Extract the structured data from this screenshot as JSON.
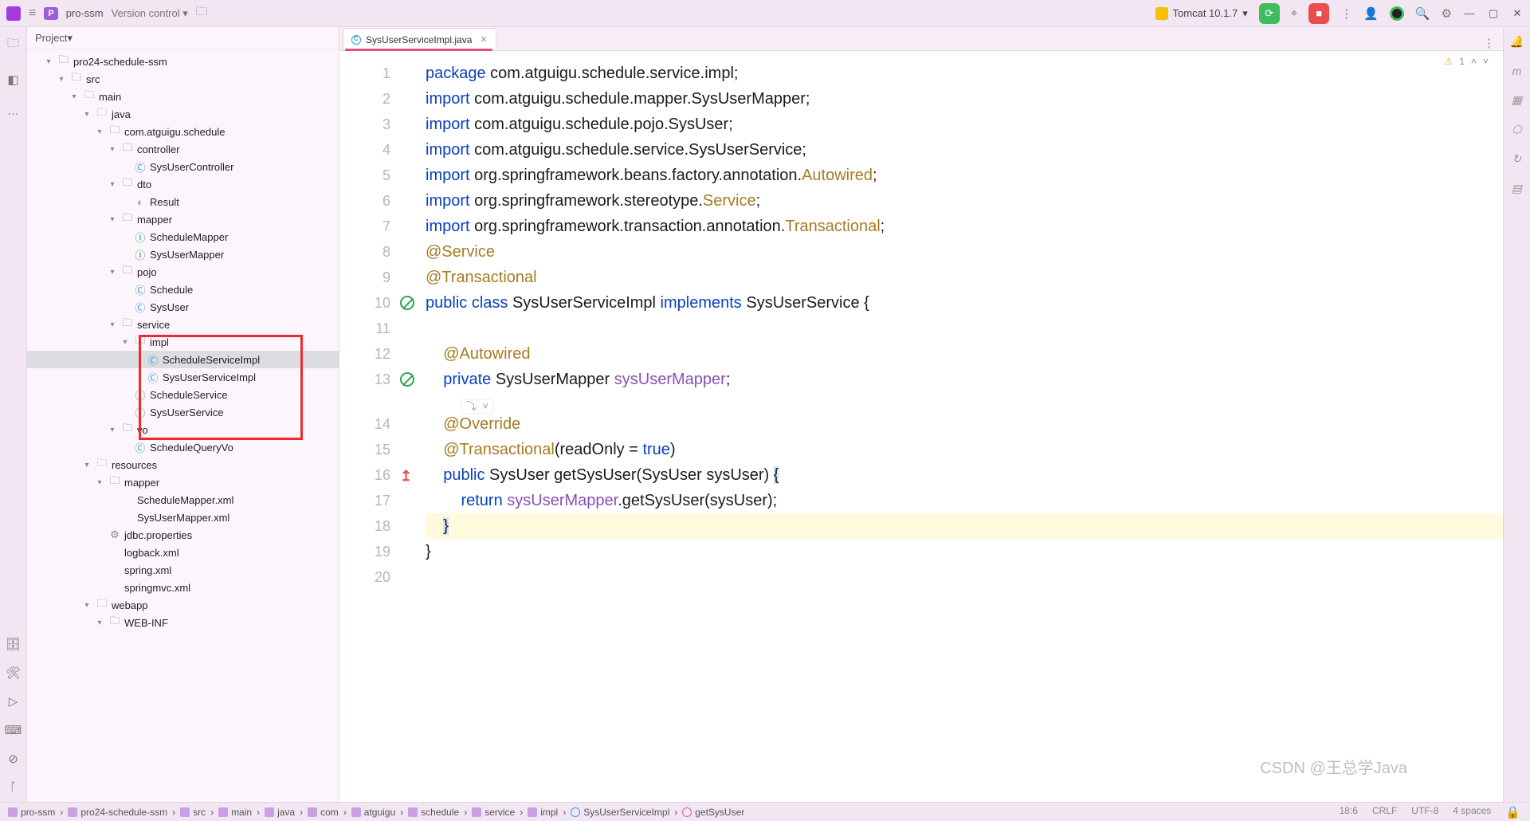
{
  "topbar": {
    "project_badge": "P",
    "project_name": "pro-ssm",
    "version_control": "Version control",
    "run_config": "Tomcat 10.1.7"
  },
  "panel": {
    "title": "Project"
  },
  "tree": {
    "root": "pro24-schedule-ssm",
    "nodes": [
      {
        "depth": 1,
        "icon": "fold-dir",
        "label": "src",
        "open": true
      },
      {
        "depth": 2,
        "icon": "fold-src",
        "label": "main",
        "open": true
      },
      {
        "depth": 3,
        "icon": "fold-src",
        "label": "java",
        "open": true
      },
      {
        "depth": 4,
        "icon": "fold-pkg",
        "label": "com.atguigu.schedule",
        "open": true
      },
      {
        "depth": 5,
        "icon": "fold-pkg",
        "label": "controller",
        "open": true
      },
      {
        "depth": 6,
        "icon": "file-class",
        "label": "SysUserController"
      },
      {
        "depth": 5,
        "icon": "fold-pkg",
        "label": "dto",
        "open": true
      },
      {
        "depth": 6,
        "icon": "file-dto",
        "label": "Result"
      },
      {
        "depth": 5,
        "icon": "fold-pkg",
        "label": "mapper",
        "open": true
      },
      {
        "depth": 6,
        "icon": "file-int",
        "label": "ScheduleMapper"
      },
      {
        "depth": 6,
        "icon": "file-int",
        "label": "SysUserMapper"
      },
      {
        "depth": 5,
        "icon": "fold-pkg",
        "label": "pojo",
        "open": true
      },
      {
        "depth": 6,
        "icon": "file-class",
        "label": "Schedule"
      },
      {
        "depth": 6,
        "icon": "file-class",
        "label": "SysUser"
      },
      {
        "depth": 5,
        "icon": "fold-pkg",
        "label": "service",
        "open": true
      },
      {
        "depth": 6,
        "icon": "fold-pkg",
        "label": "impl",
        "open": true
      },
      {
        "depth": 7,
        "icon": "file-class",
        "label": "ScheduleServiceImpl",
        "selected": true
      },
      {
        "depth": 7,
        "icon": "file-class",
        "label": "SysUserServiceImpl"
      },
      {
        "depth": 6,
        "icon": "file-int",
        "label": "ScheduleService"
      },
      {
        "depth": 6,
        "icon": "file-int",
        "label": "SysUserService"
      },
      {
        "depth": 5,
        "icon": "fold-pkg",
        "label": "vo",
        "open": true
      },
      {
        "depth": 6,
        "icon": "file-class",
        "label": "ScheduleQueryVo"
      },
      {
        "depth": 3,
        "icon": "fold-src",
        "label": "resources",
        "open": true
      },
      {
        "depth": 4,
        "icon": "fold-dir",
        "label": "mapper",
        "open": true
      },
      {
        "depth": 5,
        "icon": "file-xml",
        "label": "ScheduleMapper.xml"
      },
      {
        "depth": 5,
        "icon": "file-xml",
        "label": "SysUserMapper.xml"
      },
      {
        "depth": 4,
        "icon": "file-prop",
        "label": "jdbc.properties"
      },
      {
        "depth": 4,
        "icon": "file-xml",
        "label": "logback.xml"
      },
      {
        "depth": 4,
        "icon": "file-xml",
        "label": "spring.xml"
      },
      {
        "depth": 4,
        "icon": "file-xml",
        "label": "springmvc.xml"
      },
      {
        "depth": 3,
        "icon": "fold-src",
        "label": "webapp",
        "open": true
      },
      {
        "depth": 4,
        "icon": "fold-dir",
        "label": "WEB-INF",
        "open": true
      }
    ]
  },
  "tab": {
    "name": "SysUserServiceImpl.java"
  },
  "editor_meta": {
    "warn_count": "1"
  },
  "code_lines": [
    {
      "n": 1,
      "html": "<span class='kw'>package</span> com.atguigu.schedule.service.impl;"
    },
    {
      "n": 2,
      "html": "<span class='kw'>import</span> com.atguigu.schedule.mapper.SysUserMapper;"
    },
    {
      "n": 3,
      "html": "<span class='kw'>import</span> com.atguigu.schedule.pojo.SysUser;"
    },
    {
      "n": 4,
      "html": "<span class='kw'>import</span> com.atguigu.schedule.service.SysUserService;"
    },
    {
      "n": 5,
      "html": "<span class='kw'>import</span> org.springframework.beans.factory.annotation.<span class='ann'>Autowired</span>;"
    },
    {
      "n": 6,
      "html": "<span class='kw'>import</span> org.springframework.stereotype.<span class='ann'>Service</span>;"
    },
    {
      "n": 7,
      "html": "<span class='kw'>import</span> org.springframework.transaction.annotation.<span class='ann'>Transactional</span>;"
    },
    {
      "n": 8,
      "html": "<span class='ann'>@Service</span>"
    },
    {
      "n": 9,
      "html": "<span class='ann'>@Transactional</span>"
    },
    {
      "n": 10,
      "html": "<span class='kw'>public class</span> SysUserServiceImpl <span class='kw'>implements</span> SysUserService {",
      "gicon": "nosmoking"
    },
    {
      "n": 11,
      "html": ""
    },
    {
      "n": 12,
      "html": "    <span class='ann'>@Autowired</span>"
    },
    {
      "n": 13,
      "html": "    <span class='kw'>private</span> SysUserMapper <span class='id-purple'>sysUserMapper</span>;",
      "gicon": "nosmoking"
    },
    {
      "inlay": true,
      "label": "⤵  ˅"
    },
    {
      "n": 14,
      "html": "    <span class='ann'>@Override</span>"
    },
    {
      "n": 15,
      "html": "    <span class='ann'>@Transactional</span>(readOnly = <span class='kw'>true</span>)"
    },
    {
      "n": 16,
      "html": "    <span class='kw'>public</span> SysUser getSysUser(SysUser sysUser) <span class='hl-sel'>{</span>",
      "gicon": "upred"
    },
    {
      "n": 17,
      "html": "        <span class='kw'>return</span> <span class='id-purple'>sysUserMapper</span>.getSysUser(sysUser);"
    },
    {
      "n": 18,
      "html": "    <span class='hl-sel'>}</span>",
      "hl": true
    },
    {
      "n": 19,
      "html": "}"
    },
    {
      "n": 20,
      "html": ""
    }
  ],
  "breadcrumbs": [
    {
      "icon": "fold",
      "label": "pro-ssm"
    },
    {
      "icon": "fold",
      "label": "pro24-schedule-ssm"
    },
    {
      "icon": "fold",
      "label": "src"
    },
    {
      "icon": "fold",
      "label": "main"
    },
    {
      "icon": "fold",
      "label": "java"
    },
    {
      "icon": "fold",
      "label": "com"
    },
    {
      "icon": "fold",
      "label": "atguigu"
    },
    {
      "icon": "fold",
      "label": "schedule"
    },
    {
      "icon": "fold",
      "label": "service"
    },
    {
      "icon": "fold",
      "label": "impl"
    },
    {
      "icon": "cls",
      "label": "SysUserServiceImpl"
    },
    {
      "icon": "meth",
      "label": "getSysUser"
    }
  ],
  "status": {
    "pos": "18:6",
    "sep": "CRLF",
    "enc": "UTF-8",
    "indent": "4 spaces"
  },
  "watermark": "CSDN @王总学Java"
}
